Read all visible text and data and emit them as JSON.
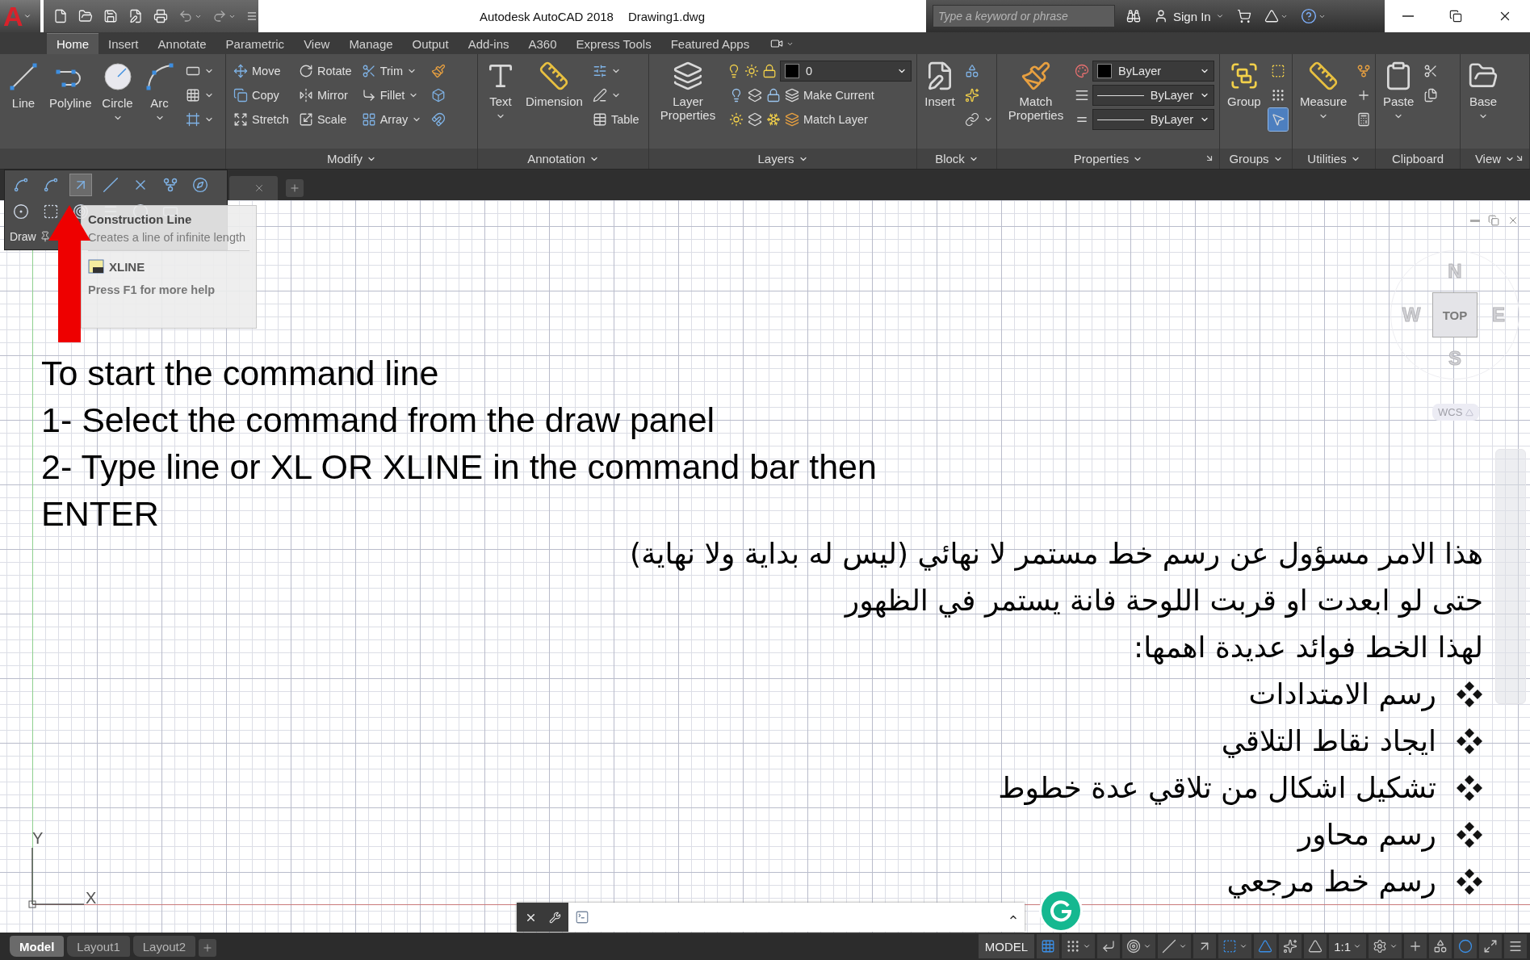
{
  "title_bar": {
    "app_button": "A",
    "title": "Autodesk AutoCAD 2018",
    "document": "Drawing1.dwg",
    "search": {
      "placeholder": "Type a keyword or phrase"
    },
    "sign_in": "Sign In"
  },
  "ribbon_tabs": [
    {
      "label": "Home",
      "selected": true
    },
    {
      "label": "Insert",
      "selected": false
    },
    {
      "label": "Annotate",
      "selected": false
    },
    {
      "label": "Parametric",
      "selected": false
    },
    {
      "label": "View",
      "selected": false
    },
    {
      "label": "Manage",
      "selected": false
    },
    {
      "label": "Output",
      "selected": false
    },
    {
      "label": "Add-ins",
      "selected": false
    },
    {
      "label": "A360",
      "selected": false
    },
    {
      "label": "Express Tools",
      "selected": false
    },
    {
      "label": "Featured Apps",
      "selected": false
    }
  ],
  "ribbon_panels": [
    {
      "columns": [
        {
          "kind": "large",
          "label": "Line",
          "caret": false
        },
        {
          "kind": "large",
          "label": "Polyline",
          "caret": false
        },
        {
          "kind": "large",
          "label": "Circle",
          "caret": true
        },
        {
          "kind": "large",
          "label": "Arc",
          "caret": true
        },
        {
          "kind": "stack",
          "rows": [
            {
              "kind": "tool",
              "caret": true
            },
            {
              "kind": "tool",
              "caret": true
            },
            {
              "kind": "tool",
              "caret": true
            }
          ]
        }
      ]
    },
    {
      "title": "Modify",
      "menu": true,
      "launcher": false,
      "columns": [
        {
          "kind": "stack",
          "rows": [
            {
              "kind": "tool",
              "label": "Move",
              "caret": false
            },
            {
              "kind": "tool",
              "label": "Copy",
              "caret": false
            },
            {
              "kind": "tool",
              "label": "Stretch",
              "caret": false
            }
          ]
        },
        {
          "kind": "stack",
          "rows": [
            {
              "kind": "tool",
              "label": "Rotate",
              "caret": false
            },
            {
              "kind": "tool",
              "label": "Mirror",
              "caret": false
            },
            {
              "kind": "tool",
              "label": "Scale",
              "caret": false
            }
          ]
        },
        {
          "kind": "stack",
          "rows": [
            {
              "kind": "tool",
              "label": "Trim",
              "caret": true
            },
            {
              "kind": "tool",
              "label": "Fillet",
              "caret": true
            },
            {
              "kind": "tool",
              "label": "Array",
              "caret": true
            }
          ]
        },
        {
          "kind": "stack",
          "rows": [
            {
              "kind": "tool",
              "caret": false
            },
            {
              "kind": "tool",
              "caret": false
            },
            {
              "kind": "tool",
              "caret": false
            }
          ]
        }
      ]
    },
    {
      "title": "Annotation",
      "menu": true,
      "launcher": false,
      "columns": [
        {
          "kind": "large",
          "label": "Text",
          "caret": true
        },
        {
          "kind": "large",
          "label": "Dimension",
          "caret": false
        },
        {
          "kind": "stack",
          "rows": [
            {
              "kind": "tool",
              "caret": true
            },
            {
              "kind": "tool",
              "caret": true
            },
            {
              "kind": "tool",
              "label": "Table",
              "caret": false
            }
          ]
        }
      ]
    },
    {
      "title": "Layers",
      "menu": true,
      "launcher": false,
      "columns": [
        {
          "kind": "large",
          "label": "Layer Properties",
          "caret": false
        },
        {
          "kind": "stack",
          "rows": [
            {
              "kind": "combo",
              "value": "0",
              "color": "#000000"
            },
            {
              "kind": "tool",
              "label": "Make Current",
              "caret": false
            },
            {
              "kind": "tool",
              "label": "Match Layer",
              "caret": false
            }
          ]
        }
      ]
    },
    {
      "title": "Block",
      "menu": true,
      "launcher": false,
      "columns": [
        {
          "kind": "large",
          "label": "Insert",
          "caret": false
        },
        {
          "kind": "stack",
          "rows": [
            {
              "kind": "tool",
              "caret": false
            },
            {
              "kind": "tool",
              "caret": false
            },
            {
              "kind": "tool",
              "caret": true
            }
          ]
        }
      ]
    },
    {
      "title": "Properties",
      "menu": true,
      "launcher": true,
      "columns": [
        {
          "kind": "large",
          "label": "Match Properties",
          "caret": false
        },
        {
          "kind": "stack",
          "rows": [
            {
              "kind": "combo",
              "value": "ByLayer",
              "color": "#000000"
            },
            {
              "kind": "linecombo",
              "value": "ByLayer"
            },
            {
              "kind": "linecombo",
              "value": "ByLayer"
            }
          ]
        }
      ]
    },
    {
      "title": "Groups",
      "menu": true,
      "launcher": false,
      "columns": [
        {
          "kind": "large",
          "label": "Group",
          "caret": false
        },
        {
          "kind": "stack",
          "rows": [
            {
              "kind": "tool",
              "caret": false,
              "on": false
            },
            {
              "kind": "tool",
              "caret": false,
              "on": false
            },
            {
              "kind": "tool",
              "caret": false,
              "on": true
            }
          ]
        }
      ]
    },
    {
      "title": "Utilities",
      "menu": true,
      "launcher": false,
      "columns": [
        {
          "kind": "large",
          "label": "Measure",
          "caret": true
        },
        {
          "kind": "stack",
          "rows": [
            {
              "kind": "tool",
              "caret": false
            },
            {
              "kind": "tool",
              "caret": false
            },
            {
              "kind": "tool",
              "caret": false
            }
          ]
        }
      ]
    },
    {
      "title": "Clipboard",
      "menu": false,
      "launcher": false,
      "columns": [
        {
          "kind": "large",
          "label": "Paste",
          "caret": true
        },
        {
          "kind": "stack",
          "rows": [
            {
              "kind": "tool",
              "caret": false
            },
            {
              "kind": "tool",
              "caret": false
            }
          ]
        }
      ]
    },
    {
      "title": "View",
      "menu": true,
      "launcher": true,
      "columns": [
        {
          "kind": "large",
          "label": "Base",
          "caret": true
        }
      ]
    }
  ],
  "draw_flyout": {
    "title": "Draw",
    "tools": [
      {
        "hovered": false
      },
      {
        "hovered": false
      },
      {
        "hovered": true
      },
      {
        "hovered": false
      },
      {
        "hovered": false
      },
      {
        "hovered": false
      },
      {
        "hovered": false
      }
    ]
  },
  "tooltip": {
    "title": "Construction Line",
    "description": "Creates a line of infinite length",
    "command": "XLINE",
    "help": "Press F1 for more help"
  },
  "instructions": [
    "To start the command line",
    "1- Select the command from the draw panel",
    "2- Type line or XL OR XLINE in the command bar then ENTER"
  ],
  "arabic_notes": {
    "lines": [
      "هذا الامر مسؤول عن رسم خط مستمر لا نهائي (ليس له بداية ولا نهاية)",
      "حتى لو ابعدت او قربت اللوحة فانة يستمر في الظهور",
      "لهذا الخط فوائد عديدة اهمها:"
    ],
    "bullets": [
      "رسم الامتدادات",
      "ايجاد نقاط التلاقي",
      "تشكيل اشكال من تلاقي عدة خطوط",
      "رسم محاور",
      "رسم خط مرجعي"
    ]
  },
  "viewcube": {
    "north": "N",
    "west": "W",
    "face": "TOP",
    "east": "E",
    "south": "S",
    "ucs": "WCS"
  },
  "ucs_icon": {
    "y_label": "Y",
    "x_label": "X"
  },
  "layout_tabs": [
    {
      "label": "Model",
      "selected": true
    },
    {
      "label": "Layout1",
      "selected": false
    },
    {
      "label": "Layout2",
      "selected": false
    }
  ],
  "status_bar": {
    "space": "MODEL",
    "toggles": [
      {
        "on": true,
        "caret": false
      },
      {
        "on": false,
        "caret": true
      },
      {
        "on": false,
        "caret": false
      },
      {
        "on": false,
        "caret": true
      },
      {
        "on": false,
        "caret": true
      },
      {
        "on": false,
        "caret": false
      },
      {
        "on": true,
        "caret": true
      },
      {
        "on": true,
        "caret": false
      },
      {
        "on": false,
        "caret": false
      },
      {
        "on": false,
        "caret": false
      }
    ],
    "scale": "1:1",
    "tools": [
      {
        "on": false,
        "caret": true
      },
      {
        "on": false,
        "caret": false
      },
      {
        "on": false,
        "caret": false
      },
      {
        "on": true,
        "caret": false
      },
      {
        "on": false,
        "caret": false
      },
      {
        "on": false,
        "caret": false
      }
    ]
  }
}
